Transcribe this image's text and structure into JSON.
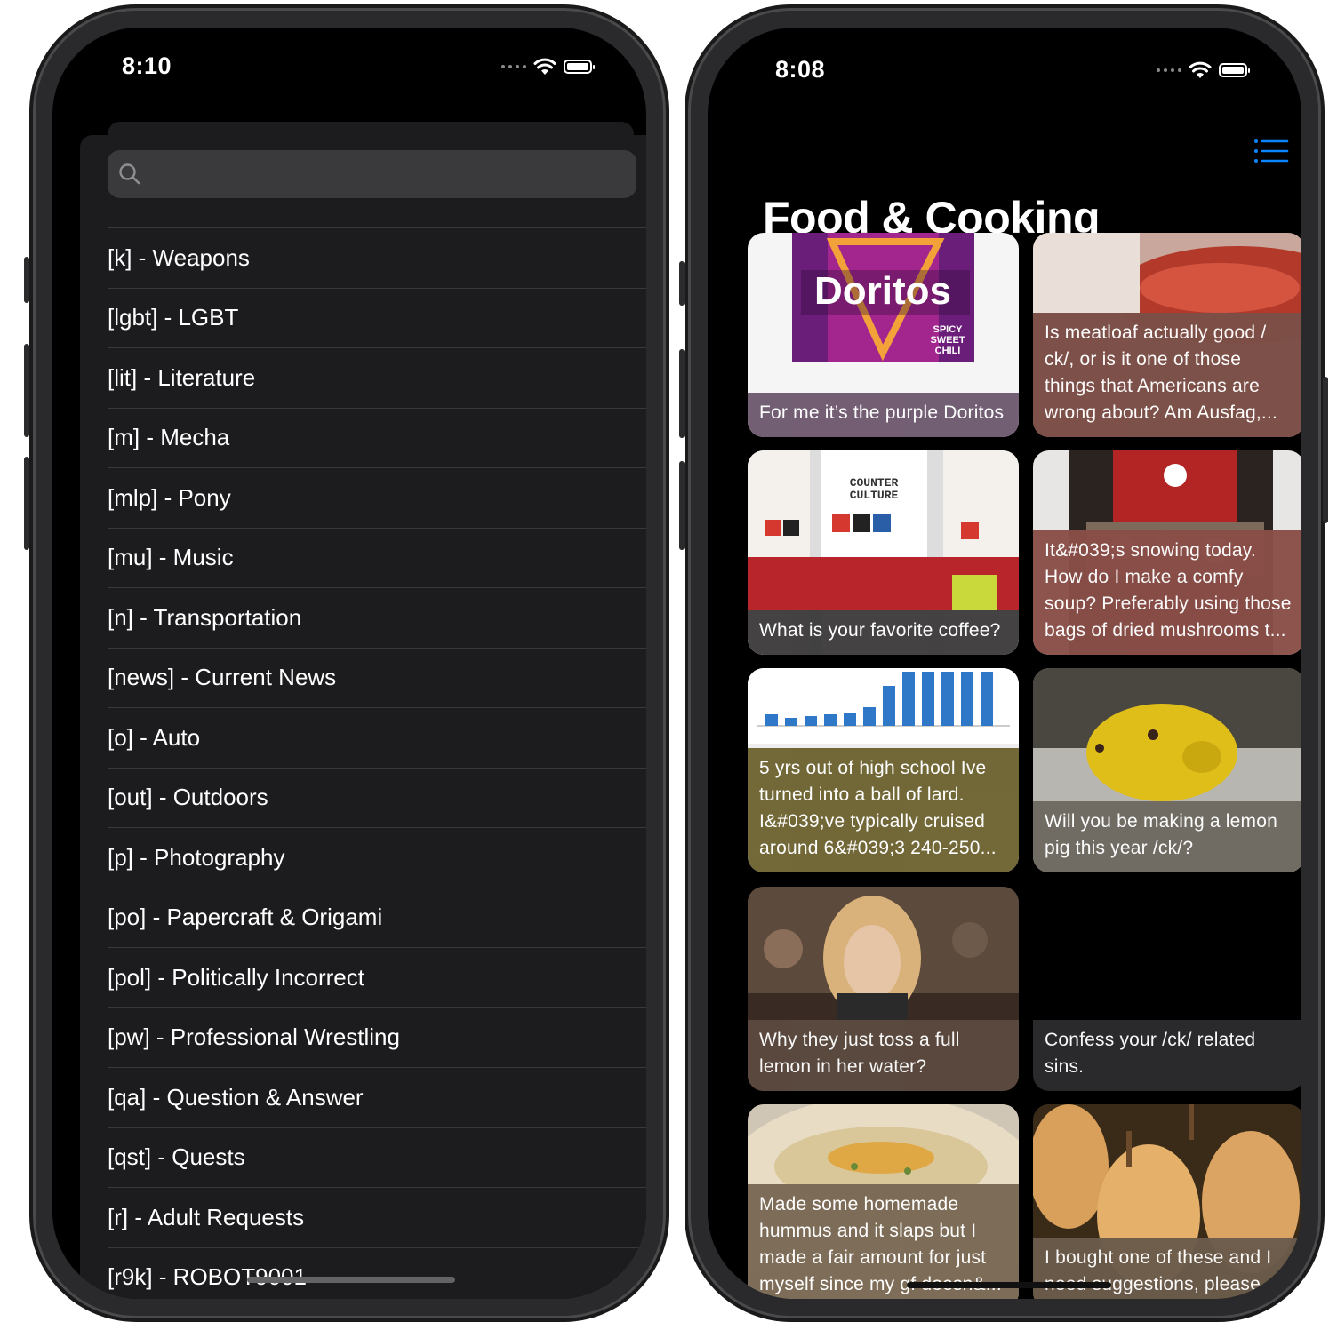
{
  "left_phone": {
    "status_time": "8:10",
    "search": {
      "placeholder": "",
      "value": ""
    },
    "boards": [
      "[k] - Weapons",
      "[lgbt] - LGBT",
      "[lit] - Literature",
      "[m] - Mecha",
      "[mlp] - Pony",
      "[mu] - Music",
      "[n] - Transportation",
      "[news] - Current News",
      "[o] - Auto",
      "[out] - Outdoors",
      "[p] - Photography",
      "[po] - Papercraft & Origami",
      "[pol] - Politically Incorrect",
      "[pw] - Professional Wrestling",
      "[qa] - Question & Answer",
      "[qst] - Quests",
      "[r] - Adult Requests",
      "[r9k] - ROBOT9001"
    ]
  },
  "right_phone": {
    "status_time": "8:08",
    "title": "Food & Cooking",
    "threads": [
      {
        "caption": "For me it’s the purple Doritos",
        "image": "doritos-bag-image",
        "tint": "#6f5a70"
      },
      {
        "caption": "Is meatloaf actually good / ck/, or is it one of those things that Americans are wrong about?  Am Ausfag,...",
        "image": "meatloaf-image",
        "tint": "#7a4f47"
      },
      {
        "caption": "What is your favorite coffee?",
        "image": "coffee-bags-image",
        "tint": "#3e3c3c"
      },
      {
        "caption": "It&#039;s snowing today. How do I make a comfy soup? Preferably using those bags of dried mushrooms t...",
        "image": "dried-mushrooms-image",
        "tint": "#8a4e48"
      },
      {
        "caption": "5 yrs out of high school Ive turned into a ball of lard. I&#039;ve typically cruised around 6&#039;3 240-250...",
        "image": "weight-chart-image",
        "tint": "#6e6432"
      },
      {
        "caption": "Will you be making a lemon pig this year /ck/?",
        "image": "lemon-pig-image",
        "tint": "#6e6a62"
      },
      {
        "caption": "Why they just toss a full lemon in her water?",
        "image": "woman-restaurant-image",
        "tint": "#5b4a3f"
      },
      {
        "caption": "Confess your /ck/ related sins.",
        "image": "",
        "tint": "#2c2c2e"
      },
      {
        "caption": "Made some homemade hummus and it slaps but I made a fair amount for just myself since my gf doesn&...",
        "image": "hummus-image",
        "tint": "#7a6a55"
      },
      {
        "caption": "I bought one of these and I need suggestions, please.",
        "image": "butternut-squash-image",
        "tint": "#6b5b4c"
      }
    ]
  }
}
